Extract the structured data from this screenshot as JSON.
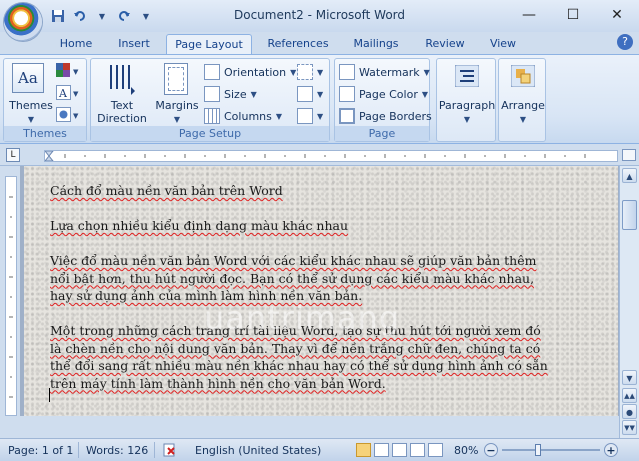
{
  "window": {
    "title": "Document2 - Microsoft Word"
  },
  "quick_access": {
    "icons": [
      "word-icon",
      "save-icon",
      "undo-icon",
      "redo-icon",
      "customize-icon"
    ]
  },
  "tabs": [
    {
      "label": "Home"
    },
    {
      "label": "Insert"
    },
    {
      "label": "Page Layout",
      "active": true
    },
    {
      "label": "References"
    },
    {
      "label": "Mailings"
    },
    {
      "label": "Review"
    },
    {
      "label": "View"
    }
  ],
  "ribbon": {
    "themes_group": {
      "label": "Themes",
      "themes_button": "Themes"
    },
    "page_setup_group": {
      "label": "Page Setup",
      "text_direction": "Text Direction",
      "margins": "Margins",
      "orientation": "Orientation",
      "size": "Size",
      "columns": "Columns"
    },
    "page_background_group": {
      "label": "Page Background",
      "watermark": "Watermark",
      "page_color": "Page Color",
      "page_borders": "Page Borders"
    },
    "paragraph_button": "Paragraph",
    "arrange_button": "Arrange"
  },
  "document": {
    "watermark_text": "uantrimang",
    "paragraphs": [
      "Cách đổ màu nền văn bản trên Word",
      "Lựa chọn nhiều kiểu định dạng màu khác nhau",
      "Việc đổ màu nền văn bản Word với các kiểu khác nhau sẽ giúp văn bản thêm nổi bật hơn, thu hút người đọc. Bạn có thể sử dụng các kiểu màu khác nhau, hay sử dụng ảnh của mình làm hình nền văn bản.",
      "Một trong những cách trang trí tài liệu Word, tạo sự thu hút tới người xem đó là chèn nền cho nội dung văn bản. Thay vì để nền trắng chữ đen, chúng ta có thể đổi sang rất nhiều màu nền khác nhau hay có thể sử dụng hình ảnh có sẵn trên máy tính làm thành hình nền cho văn bản Word."
    ]
  },
  "status": {
    "page": "Page: 1 of 1",
    "words": "Words: 126",
    "language": "English (United States)",
    "zoom": "80%"
  },
  "colors": {
    "ribbon_accent": "#15428b",
    "spell_underline": "#e02020"
  }
}
